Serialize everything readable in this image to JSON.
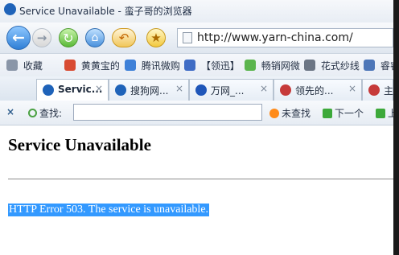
{
  "window": {
    "title": "Service Unavailable - 蛮子哥的浏览器"
  },
  "navbar": {
    "url": "http://www.yarn-china.com/",
    "icons": {
      "back": "back-arrow-icon",
      "forward": "forward-arrow-icon",
      "reload": "reload-icon",
      "home": "home-icon",
      "undo": "undo-icon",
      "favorites": "star-icon"
    }
  },
  "bookmarks": [
    {
      "label": "收藏",
      "icon": "bookmark-folder-icon",
      "color": "#8a96a8"
    },
    {
      "label": "黄黄宝的",
      "icon": "app-icon",
      "color": "#d84b32"
    },
    {
      "label": "腾讯微购",
      "icon": "app-icon",
      "color": "#3f81d8"
    },
    {
      "label": "【领迅】",
      "icon": "app-icon",
      "color": "#3f6cc5"
    },
    {
      "label": "畅销网微",
      "icon": "app-icon",
      "color": "#5bb54e"
    },
    {
      "label": "花式纱线",
      "icon": "app-icon",
      "color": "#6c7685"
    },
    {
      "label": "睿睿",
      "icon": "app-icon",
      "color": "#4e77b8"
    }
  ],
  "tabs": [
    {
      "label": "Servic...",
      "active": true,
      "icon": "sogou-icon",
      "color": "#1f63b9"
    },
    {
      "label": "搜狗网...",
      "active": false,
      "icon": "sogou-icon",
      "color": "#1f63b9"
    },
    {
      "label": "万网_...",
      "active": false,
      "icon": "paw-icon",
      "color": "#1f56b9"
    },
    {
      "label": "领先的...",
      "active": false,
      "icon": "diamond-icon",
      "color": "#c63a3a"
    },
    {
      "label": "主",
      "active": false,
      "icon": "diamond-icon",
      "color": "#c63a3a"
    }
  ],
  "findbar": {
    "label": "查找:",
    "value": "",
    "not_found": "未查找",
    "next": "下一个",
    "prev": "上"
  },
  "page": {
    "heading": "Service Unavailable",
    "error": "HTTP Error 503. The service is unavailable."
  }
}
